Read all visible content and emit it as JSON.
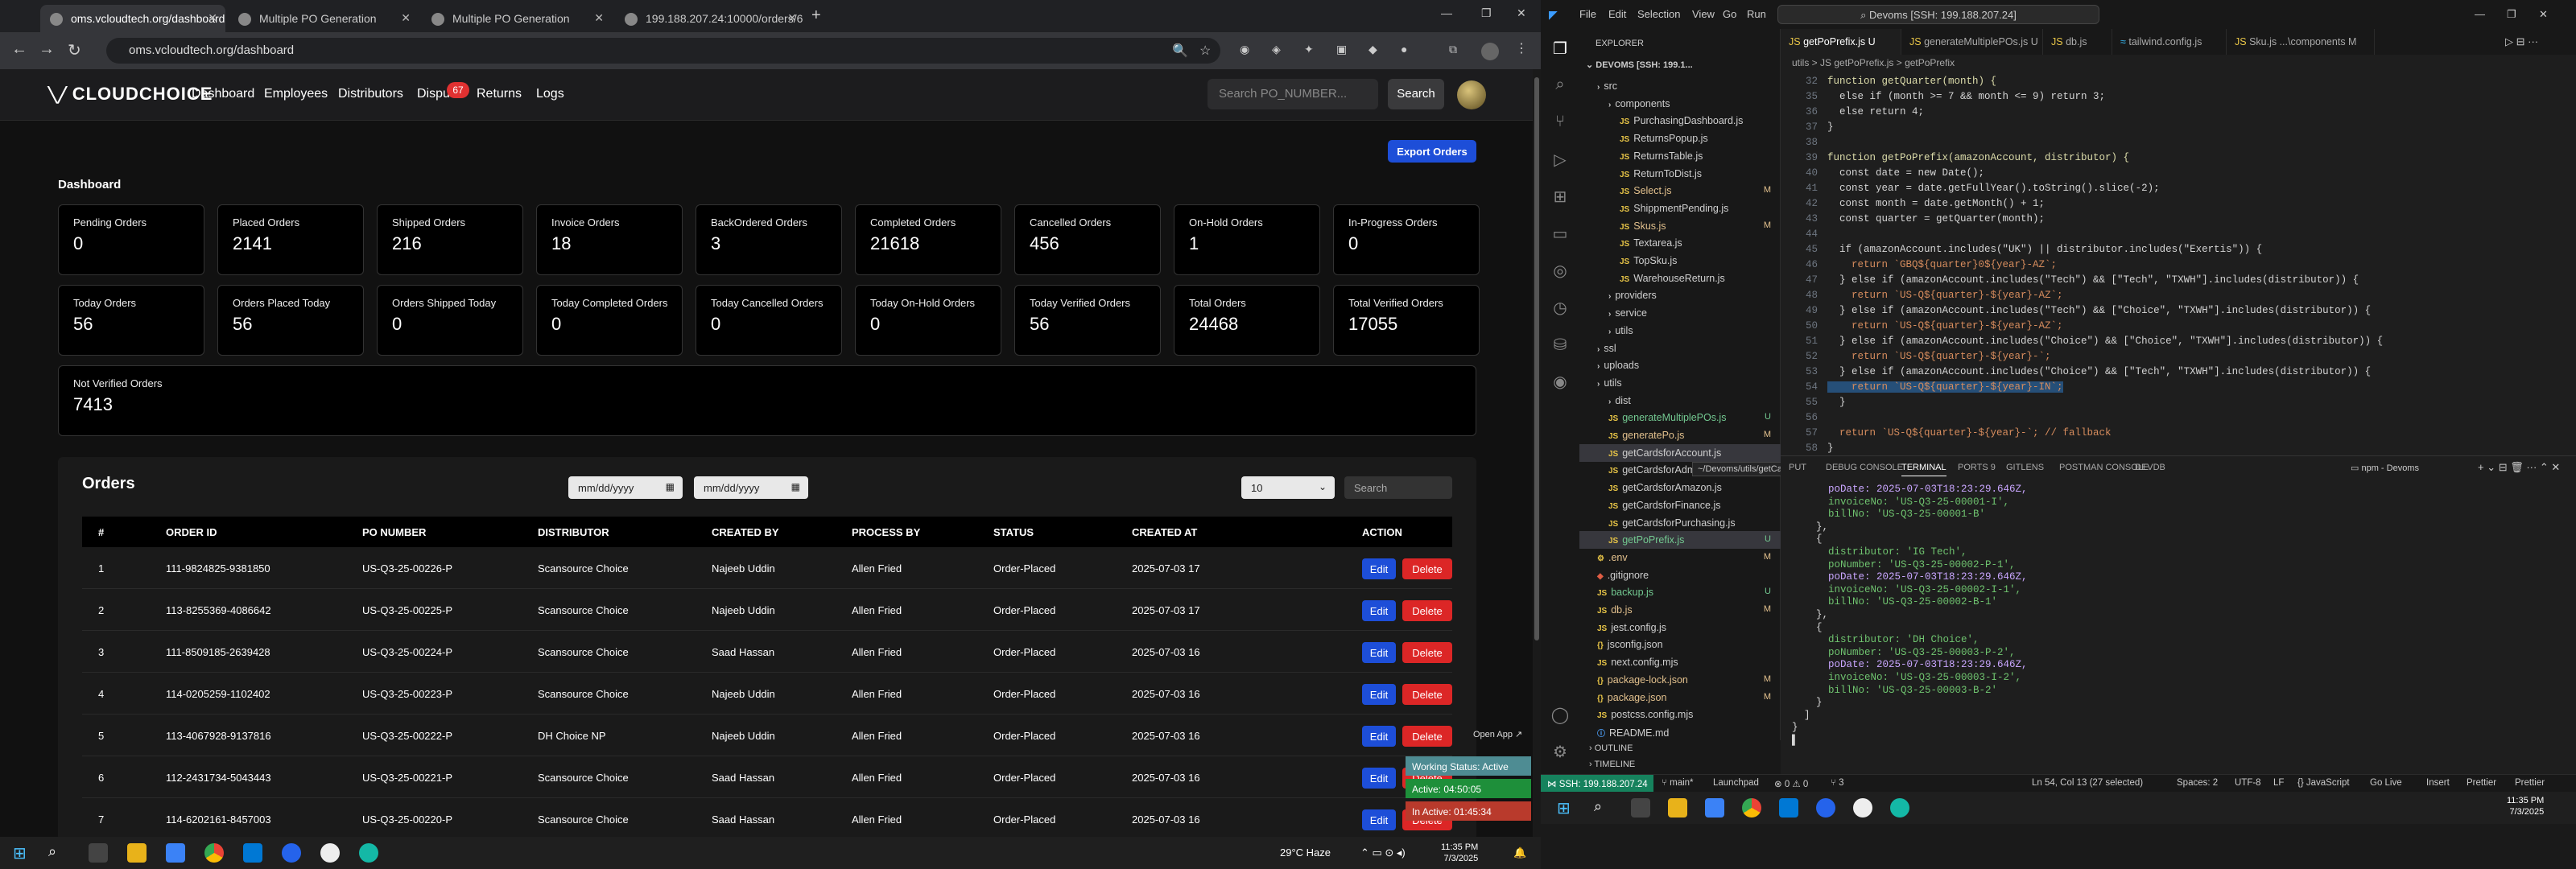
{
  "browser": {
    "tabs": [
      {
        "label": "oms.vcloudtech.org/dashboard"
      },
      {
        "label": "Multiple PO Generation"
      },
      {
        "label": "Multiple PO Generation"
      },
      {
        "label": "199.188.207.24:10000/orders/6"
      }
    ],
    "url": "oms.vcloudtech.org/dashboard"
  },
  "app": {
    "logo": "CLOUDCHOICE",
    "nav": [
      "Dashboard",
      "Employees",
      "Distributors",
      "Dispu",
      "Returns",
      "Logs"
    ],
    "dispute_badge": "67",
    "search_placeholder": "Search PO_NUMBER...",
    "search_button": "Search",
    "export_button": "Export Orders",
    "dashboard_title": "Dashboard",
    "cards": [
      {
        "label": "Pending Orders",
        "value": "0"
      },
      {
        "label": "Placed Orders",
        "value": "2141"
      },
      {
        "label": "Shipped Orders",
        "value": "216"
      },
      {
        "label": "Invoice Orders",
        "value": "18"
      },
      {
        "label": "BackOrdered Orders",
        "value": "3"
      },
      {
        "label": "Completed Orders",
        "value": "21618"
      },
      {
        "label": "Cancelled Orders",
        "value": "456"
      },
      {
        "label": "On-Hold Orders",
        "value": "1"
      },
      {
        "label": "In-Progress Orders",
        "value": "0"
      },
      {
        "label": "Today Orders",
        "value": "56"
      },
      {
        "label": "Orders Placed Today",
        "value": "56"
      },
      {
        "label": "Orders Shipped Today",
        "value": "0"
      },
      {
        "label": "Today Completed Orders",
        "value": "0"
      },
      {
        "label": "Today Cancelled Orders",
        "value": "0"
      },
      {
        "label": "Today On-Hold Orders",
        "value": "0"
      },
      {
        "label": "Today Verified Orders",
        "value": "56"
      },
      {
        "label": "Total Orders",
        "value": "24468"
      },
      {
        "label": "Total Verified Orders",
        "value": "17055"
      },
      {
        "label": "Not Verified Orders",
        "value": "7413"
      }
    ],
    "orders": {
      "title": "Orders",
      "date_placeholder": "mm/dd/yyyy",
      "page_size": "10",
      "search_placeholder": "Search",
      "columns": [
        "#",
        "ORDER ID",
        "PO NUMBER",
        "DISTRIBUTOR",
        "CREATED BY",
        "PROCESS BY",
        "STATUS",
        "CREATED AT",
        "ACTION"
      ],
      "edit_label": "Edit",
      "delete_label": "Delete",
      "rows": [
        [
          "1",
          "111-9824825-9381850",
          "US-Q3-25-00226-P",
          "Scansource Choice",
          "Najeeb Uddin",
          "Allen Fried",
          "Order-Placed",
          "2025-07-03 17"
        ],
        [
          "2",
          "113-8255369-4086642",
          "US-Q3-25-00225-P",
          "Scansource Choice",
          "Najeeb Uddin",
          "Allen Fried",
          "Order-Placed",
          "2025-07-03 17"
        ],
        [
          "3",
          "111-8509185-2639428",
          "US-Q3-25-00224-P",
          "Scansource Choice",
          "Saad Hassan",
          "Allen Fried",
          "Order-Placed",
          "2025-07-03 16"
        ],
        [
          "4",
          "114-0205259-1102402",
          "US-Q3-25-00223-P",
          "Scansource Choice",
          "Najeeb Uddin",
          "Allen Fried",
          "Order-Placed",
          "2025-07-03 16"
        ],
        [
          "5",
          "113-4067928-9137816",
          "US-Q3-25-00222-P",
          "DH Choice NP",
          "Najeeb Uddin",
          "Allen Fried",
          "Order-Placed",
          "2025-07-03 16"
        ],
        [
          "6",
          "112-2431734-5043443",
          "US-Q3-25-00221-P",
          "Scansource Choice",
          "Saad Hassan",
          "Allen Fried",
          "Order-Placed",
          "2025-07-03 16"
        ],
        [
          "7",
          "114-6202161-8457003",
          "US-Q3-25-00220-P",
          "Scansource Choice",
          "Saad Hassan",
          "Allen Fried",
          "Order-Placed",
          "2025-07-03 16"
        ]
      ]
    },
    "tracker": {
      "open_app": "Open App ↗",
      "status": "Working Status: Active",
      "active": "Active: 04:50:05",
      "inactive": "In Active: 01:45:34"
    }
  },
  "taskbar_left": {
    "weather": "29°C  Haze",
    "time": "11:35 PM",
    "date": "7/3/2025"
  },
  "vscode": {
    "menu": [
      "File",
      "Edit",
      "Selection",
      "View",
      "Go",
      "Run",
      "···"
    ],
    "command_center": "Devoms [SSH: 199.188.207.24]",
    "explorer_title": "EXPLORER",
    "root": "DEVOMS [SSH: 199.1...",
    "tree": [
      {
        "name": "src",
        "indent": 1,
        "kind": "folder",
        "mark": ""
      },
      {
        "name": "components",
        "indent": 2,
        "kind": "folder",
        "mark": ""
      },
      {
        "name": "PurchasingDashboard.js",
        "indent": 3,
        "kind": "js",
        "mark": ""
      },
      {
        "name": "ReturnsPopup.js",
        "indent": 3,
        "kind": "js",
        "mark": ""
      },
      {
        "name": "ReturnsTable.js",
        "indent": 3,
        "kind": "js",
        "mark": ""
      },
      {
        "name": "ReturnToDist.js",
        "indent": 3,
        "kind": "js",
        "mark": ""
      },
      {
        "name": "Select.js",
        "indent": 3,
        "kind": "js",
        "mark": "M"
      },
      {
        "name": "ShippmentPending.js",
        "indent": 3,
        "kind": "js",
        "mark": ""
      },
      {
        "name": "Skus.js",
        "indent": 3,
        "kind": "js",
        "mark": "M"
      },
      {
        "name": "Textarea.js",
        "indent": 3,
        "kind": "js",
        "mark": ""
      },
      {
        "name": "TopSku.js",
        "indent": 3,
        "kind": "js",
        "mark": ""
      },
      {
        "name": "WarehouseReturn.js",
        "indent": 3,
        "kind": "js",
        "mark": ""
      },
      {
        "name": "providers",
        "indent": 2,
        "kind": "folder",
        "mark": ""
      },
      {
        "name": "service",
        "indent": 2,
        "kind": "folder",
        "mark": ""
      },
      {
        "name": "utils",
        "indent": 2,
        "kind": "folder",
        "mark": ""
      },
      {
        "name": "ssl",
        "indent": 1,
        "kind": "folder",
        "mark": ""
      },
      {
        "name": "uploads",
        "indent": 1,
        "kind": "folder",
        "mark": ""
      },
      {
        "name": "utils",
        "indent": 1,
        "kind": "folder",
        "mark": ""
      },
      {
        "name": "dist",
        "indent": 2,
        "kind": "folder",
        "mark": ""
      },
      {
        "name": "generateMultiplePOs.js",
        "indent": 2,
        "kind": "js",
        "mark": "U"
      },
      {
        "name": "generatePo.js",
        "indent": 2,
        "kind": "js",
        "mark": "M"
      },
      {
        "name": "getCardsforAccount.js",
        "indent": 2,
        "kind": "js",
        "mark": ""
      },
      {
        "name": "getCardsforAdmin...",
        "indent": 2,
        "kind": "js",
        "mark": ""
      },
      {
        "name": "getCardsforAmazon.js",
        "indent": 2,
        "kind": "js",
        "mark": ""
      },
      {
        "name": "getCardsforFinance.js",
        "indent": 2,
        "kind": "js",
        "mark": ""
      },
      {
        "name": "getCardsforPurchasing.js",
        "indent": 2,
        "kind": "js",
        "mark": ""
      },
      {
        "name": "getPoPrefix.js",
        "indent": 2,
        "kind": "js",
        "mark": "U"
      },
      {
        "name": ".env",
        "indent": 1,
        "kind": "env",
        "mark": "M"
      },
      {
        "name": ".gitignore",
        "indent": 1,
        "kind": "git",
        "mark": ""
      },
      {
        "name": "backup.js",
        "indent": 1,
        "kind": "js",
        "mark": "U"
      },
      {
        "name": "db.js",
        "indent": 1,
        "kind": "js",
        "mark": "M"
      },
      {
        "name": "jest.config.js",
        "indent": 1,
        "kind": "js",
        "mark": ""
      },
      {
        "name": "jsconfig.json",
        "indent": 1,
        "kind": "json",
        "mark": ""
      },
      {
        "name": "next.config.mjs",
        "indent": 1,
        "kind": "js",
        "mark": ""
      },
      {
        "name": "package-lock.json",
        "indent": 1,
        "kind": "json",
        "mark": "M"
      },
      {
        "name": "package.json",
        "indent": 1,
        "kind": "json",
        "mark": "M"
      },
      {
        "name": "postcss.config.mjs",
        "indent": 1,
        "kind": "js",
        "mark": ""
      },
      {
        "name": "README.md",
        "indent": 1,
        "kind": "md",
        "mark": ""
      }
    ],
    "tooltip": "~/Devoms/utils/getCardsforAccount.js",
    "outline": "OUTLINE",
    "timeline": "TIMELINE",
    "tabs": [
      "getPoPrefix.js U",
      "generateMultiplePOs.js U",
      "db.js",
      "tailwind.config.js",
      "Sku.js ...\\components M"
    ],
    "breadcrumbs": "utils  >  JS getPoPrefix.js  >  getPoPrefix",
    "code": [
      {
        "n": "32",
        "text": "function getQuarter(month) {"
      },
      {
        "n": "35",
        "text": "  else if (month >= 7 && month <= 9) return 3;"
      },
      {
        "n": "36",
        "text": "  else return 4;"
      },
      {
        "n": "37",
        "text": "}"
      },
      {
        "n": "38",
        "text": ""
      },
      {
        "n": "39",
        "text": "function getPoPrefix(amazonAccount, distributor) {"
      },
      {
        "n": "40",
        "text": "  const date = new Date();"
      },
      {
        "n": "41",
        "text": "  const year = date.getFullYear().toString().slice(-2);"
      },
      {
        "n": "42",
        "text": "  const month = date.getMonth() + 1;"
      },
      {
        "n": "43",
        "text": "  const quarter = getQuarter(month);"
      },
      {
        "n": "44",
        "text": ""
      },
      {
        "n": "45",
        "text": "  if (amazonAccount.includes(\"UK\") || distributor.includes(\"Exertis\")) {"
      },
      {
        "n": "46",
        "text": "    return `GBQ${quarter}0${year}-AZ`;"
      },
      {
        "n": "47",
        "text": "  } else if (amazonAccount.includes(\"Tech\") && [\"Tech\", \"TXWH\"].includes(distributor)) {"
      },
      {
        "n": "48",
        "text": "    return `US-Q${quarter}-${year}-AZ`;"
      },
      {
        "n": "49",
        "text": "  } else if (amazonAccount.includes(\"Tech\") && [\"Choice\", \"TXWH\"].includes(distributor)) {"
      },
      {
        "n": "50",
        "text": "    return `US-Q${quarter}-${year}-AZ`;"
      },
      {
        "n": "51",
        "text": "  } else if (amazonAccount.includes(\"Choice\") && [\"Choice\", \"TXWH\"].includes(distributor)) {"
      },
      {
        "n": "52",
        "text": "    return `US-Q${quarter}-${year}-`;"
      },
      {
        "n": "53",
        "text": "  } else if (amazonAccount.includes(\"Choice\") && [\"Tech\", \"TXWH\"].includes(distributor)) {"
      },
      {
        "n": "54",
        "text": "    return `US-Q${quarter}-${year}-IN`;"
      },
      {
        "n": "55",
        "text": "  }"
      },
      {
        "n": "56",
        "text": ""
      },
      {
        "n": "57",
        "text": "  return `US-Q${quarter}-${year}-`; // fallback"
      },
      {
        "n": "58",
        "text": "}"
      }
    ],
    "panel_tabs": [
      "PUT",
      "DEBUG CONSOLE",
      "TERMINAL",
      "PORTS 9",
      "GITLENS",
      "POSTMAN CONSOLE",
      "DEVDB"
    ],
    "terminal_title": "npm - Devoms",
    "terminal": [
      "      poDate: 2025-07-03T18:23:29.646Z,",
      "      invoiceNo: 'US-Q3-25-00001-I',",
      "      billNo: 'US-Q3-25-00001-B'",
      "    },",
      "    {",
      "      distributor: 'IG Tech',",
      "      poNumber: 'US-Q3-25-00002-P-1',",
      "      poDate: 2025-07-03T18:23:29.646Z,",
      "      invoiceNo: 'US-Q3-25-00002-I-1',",
      "      billNo: 'US-Q3-25-00002-B-1'",
      "    },",
      "    {",
      "      distributor: 'DH Choice',",
      "      poNumber: 'US-Q3-25-00003-P-2',",
      "      poDate: 2025-07-03T18:23:29.646Z,",
      "      invoiceNo: 'US-Q3-25-00003-I-2',",
      "      billNo: 'US-Q3-25-00003-B-2'",
      "    }",
      "  ]",
      "}",
      "▌"
    ],
    "status": {
      "ssh": "SSH: 199.188.207.24",
      "branch": "main*",
      "launchpad": "Launchpad",
      "problems": "⊗ 0 ⚠ 0",
      "ports": "⑂ 3",
      "cursor": "Ln 54, Col 13 (27 selected)",
      "spaces": "Spaces: 2",
      "encoding": "UTF-8",
      "eol": "LF",
      "lang": "{} JavaScript",
      "golive": "Go Live",
      "insert": "Insert",
      "prettier": "Prettier"
    },
    "clock": {
      "time": "11:35 PM",
      "date": "7/3/2025"
    }
  },
  "colors": {
    "edit": "#1d4ed8",
    "delete": "#dc2626",
    "ssh": "#16825d"
  }
}
